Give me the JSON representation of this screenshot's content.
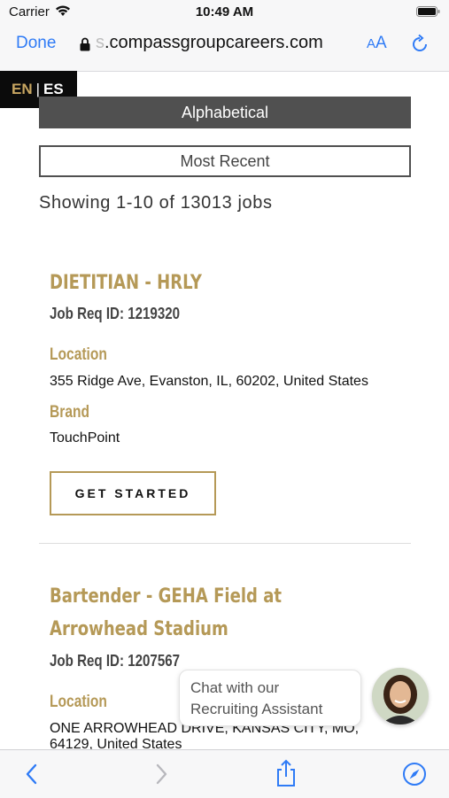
{
  "status_bar": {
    "carrier": "Carrier",
    "time": "10:49 AM"
  },
  "browser": {
    "done_label": "Done",
    "url_fade": "s",
    "url_domain": ".compassgroupcareers.com",
    "text_size_small": "A",
    "text_size_large": "A"
  },
  "language": {
    "active": "EN",
    "separator": "|",
    "other": "ES"
  },
  "sort": {
    "alphabetical_label": "Alphabetical",
    "most_recent_label": "Most Recent"
  },
  "results": {
    "showing_text": "Showing 1-10 of 13013 jobs"
  },
  "jobs": [
    {
      "title": "DIETITIAN - HRLY",
      "req_id": "Job Req ID: 1219320",
      "location_label": "Location",
      "location": "355 Ridge Ave, Evanston, IL, 60202, United States",
      "brand_label": "Brand",
      "brand": "TouchPoint",
      "cta_label": "GET STARTED"
    },
    {
      "title": "Bartender - GEHA Field at Arrowhead Stadium",
      "req_id": "Job Req ID: 1207567",
      "location_label": "Location",
      "location": "ONE ARROWHEAD DRIVE, KANSAS CITY, MO, 64129, United States"
    }
  ],
  "chat": {
    "line1": "Chat with our",
    "line2": "Recruiting Assistant"
  },
  "toolbar_icons": [
    "back-icon",
    "forward-icon",
    "share-icon",
    "compass-icon"
  ],
  "colors": {
    "accent_gold": "#b59957",
    "ios_blue": "#2f7bf6",
    "dark_button": "#505050"
  }
}
